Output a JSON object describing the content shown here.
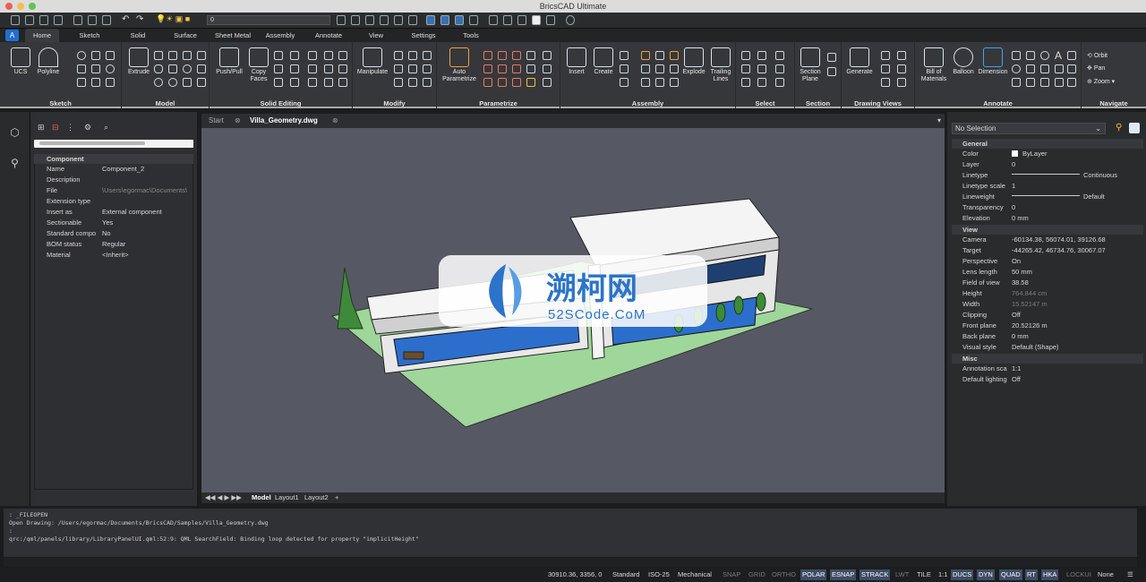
{
  "window": {
    "title": "BricsCAD Ultimate"
  },
  "qat": {
    "layer_value": "0"
  },
  "tabs": [
    "Home",
    "Sketch",
    "Solid",
    "Surface",
    "Sheet Metal",
    "Assembly",
    "Annotate",
    "View",
    "Settings",
    "Tools"
  ],
  "active_tab": "Home",
  "ribbon": {
    "groups": [
      {
        "title": "Sketch",
        "buttons": [
          "UCS",
          "Polyline"
        ]
      },
      {
        "title": "Model",
        "buttons": [
          "Extrude"
        ]
      },
      {
        "title": "Solid Editing",
        "buttons": [
          "Push/Pull",
          "Copy Faces"
        ]
      },
      {
        "title": "Modify",
        "buttons": [
          "Manipulate"
        ]
      },
      {
        "title": "Parametrize",
        "buttons": [
          "Auto Parametrize"
        ]
      },
      {
        "title": "Assembly",
        "buttons": [
          "Insert",
          "Create",
          "Explode",
          "Trailing Lines"
        ]
      },
      {
        "title": "Select",
        "buttons": []
      },
      {
        "title": "Section",
        "buttons": [
          "Section Plane"
        ]
      },
      {
        "title": "Drawing Views",
        "buttons": [
          "Generate"
        ]
      },
      {
        "title": "Annotate",
        "buttons": [
          "Bill of Materials",
          "Balloon",
          "Dimension"
        ]
      },
      {
        "title": "Navigate",
        "buttons": [
          "Orbit",
          "Pan",
          "Zoom"
        ]
      }
    ]
  },
  "left_panel": {
    "section": "Component",
    "rows": [
      {
        "k": "Name",
        "v": "Component_2"
      },
      {
        "k": "Description",
        "v": ""
      },
      {
        "k": "File",
        "v": "\\Users\\egormac\\Documents\\"
      },
      {
        "k": "Extension type",
        "v": ""
      },
      {
        "k": "Insert as",
        "v": "External component"
      },
      {
        "k": "Sectionable",
        "v": "Yes"
      },
      {
        "k": "Standard compo",
        "v": "No"
      },
      {
        "k": "BOM status",
        "v": "Regular"
      },
      {
        "k": "Material",
        "v": "<Inherit>"
      }
    ]
  },
  "doc_tabs": {
    "start": "Start",
    "active": "Villa_Geometry.dwg"
  },
  "layout_tabs": [
    "Model",
    "Layout1",
    "Layout2",
    "+"
  ],
  "watermark": {
    "title": "溯柯网",
    "subtitle": "52SCode.CoM"
  },
  "right_panel": {
    "selection": "No Selection",
    "general_title": "General",
    "general": [
      {
        "k": "Color",
        "v": "ByLayer"
      },
      {
        "k": "Layer",
        "v": "0"
      },
      {
        "k": "Linetype",
        "v": "Continuous"
      },
      {
        "k": "Linetype scale",
        "v": "1"
      },
      {
        "k": "Lineweight",
        "v": "Default"
      },
      {
        "k": "Transparency",
        "v": "0"
      },
      {
        "k": "Elevation",
        "v": "0 mm"
      }
    ],
    "view_title": "View",
    "view": [
      {
        "k": "Camera",
        "v": "-60134.38, 56074.01, 39126.68"
      },
      {
        "k": "Target",
        "v": "-44265.42, 46734.76, 30067.07"
      },
      {
        "k": "Perspective",
        "v": "On"
      },
      {
        "k": "Lens length",
        "v": "50 mm"
      },
      {
        "k": "Field of view",
        "v": "38.58"
      },
      {
        "k": "Height",
        "v": "764.844 cm"
      },
      {
        "k": "Width",
        "v": "15.52147 m"
      },
      {
        "k": "Clipping",
        "v": "Off"
      },
      {
        "k": "Front plane",
        "v": "20.52126 m"
      },
      {
        "k": "Back plane",
        "v": "0 mm"
      },
      {
        "k": "Visual style",
        "v": "Default (Shape)"
      }
    ],
    "misc_title": "Misc",
    "misc": [
      {
        "k": "Annotation sca",
        "v": "1:1"
      },
      {
        "k": "Default lighting",
        "v": "Off"
      }
    ]
  },
  "command_lines": [
    ": _FILEOPEN",
    "Open Drawing: /Users/egormac/Documents/BricsCAD/Samples/Villa_Geometry.dwg",
    ":",
    "qrc:/qml/panels/library/LibraryPanelUI.qml:52:9: QML SearchField: Binding loop detected for property \"implicitHeight\""
  ],
  "status": {
    "coords": "30910.36, 3356, 0",
    "items": [
      {
        "t": "Standard",
        "s": "n"
      },
      {
        "t": "ISO-25",
        "s": "n"
      },
      {
        "t": "Mechanical",
        "s": "n"
      },
      {
        "t": "SNAP",
        "s": "off"
      },
      {
        "t": "GRID",
        "s": "off"
      },
      {
        "t": "ORTHO",
        "s": "off"
      },
      {
        "t": "POLAR",
        "s": "on"
      },
      {
        "t": "ESNAP",
        "s": "on"
      },
      {
        "t": "STRACK",
        "s": "on"
      },
      {
        "t": "LWT",
        "s": "off"
      },
      {
        "t": "TILE",
        "s": "n"
      },
      {
        "t": "1:1",
        "s": "n"
      },
      {
        "t": "DUCS",
        "s": "on"
      },
      {
        "t": "DYN",
        "s": "on"
      },
      {
        "t": "QUAD",
        "s": "on"
      },
      {
        "t": "RT",
        "s": "on"
      },
      {
        "t": "HKA",
        "s": "on"
      },
      {
        "t": "LOCKUI",
        "s": "off"
      },
      {
        "t": "None",
        "s": "n"
      }
    ]
  }
}
